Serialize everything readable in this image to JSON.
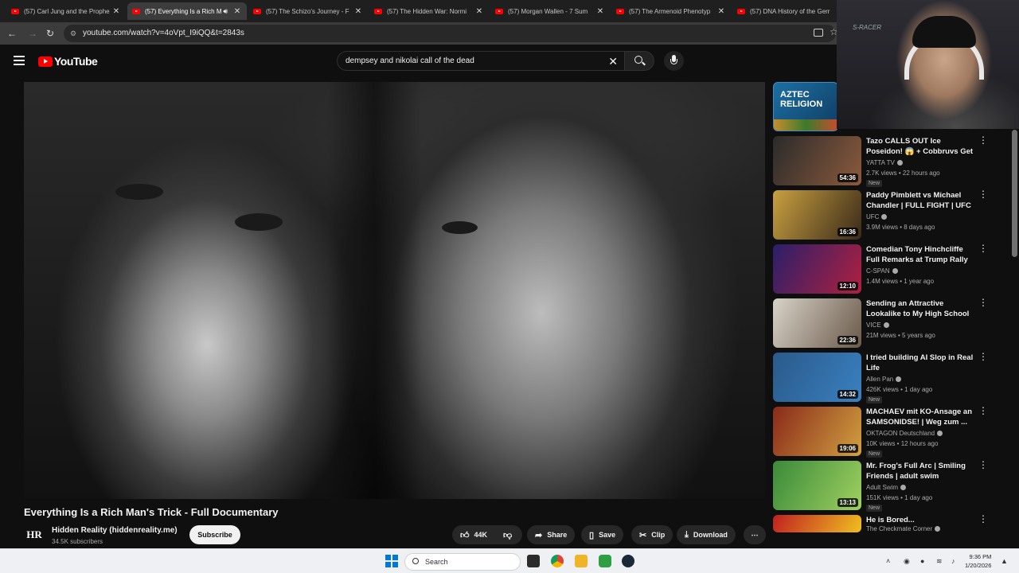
{
  "browser": {
    "tabs": [
      {
        "title": "(57) Carl Jung and the Prophe",
        "active": false,
        "audio": false
      },
      {
        "title": "(57) Everything Is a Rich M",
        "active": true,
        "audio": true
      },
      {
        "title": "(57) The Schizo's Journey - F",
        "active": false,
        "audio": false
      },
      {
        "title": "(57) The Hidden War: Normi",
        "active": false,
        "audio": false
      },
      {
        "title": "(57) Morgan Wallen - 7 Sum",
        "active": false,
        "audio": false
      },
      {
        "title": "(57) The Armenoid Phenotyp",
        "active": false,
        "audio": false
      },
      {
        "title": "(57) DNA History of the Gerr",
        "active": false,
        "audio": false
      }
    ],
    "url": "youtube.com/watch?v=4oVpt_I9iQQ&t=2843s"
  },
  "header": {
    "logo_text": "YouTube",
    "search_query": "dempsey and nikolai call of the dead"
  },
  "video": {
    "title": "Everything Is a Rich Man's Trick - Full Documentary",
    "channel": "Hidden Reality (hiddenreality.me)",
    "avatar_text": "HR",
    "subscribers": "34.5K subscribers",
    "subscribe_label": "Subscribe",
    "likes": "44K",
    "share_label": "Share",
    "save_label": "Save",
    "clip_label": "Clip",
    "download_label": "Download"
  },
  "sidebar": {
    "ad_title": "AZTEC RELIGION",
    "items": [
      {
        "title": "Tazo CALLS OUT Ice Poseidon! 😱 + Cobbruvs Get PRESSED ...",
        "channel": "YATTA TV",
        "meta": "2.7K views • 22 hours ago",
        "badge": "New",
        "duration": "54:36",
        "colors": [
          "#2b2b2b",
          "#8b5a3c"
        ]
      },
      {
        "title": "Paddy Pimblett vs Michael Chandler | FULL FIGHT | UFC ...",
        "channel": "UFC",
        "meta": "3.9M views • 8 days ago",
        "badge": "",
        "duration": "16:36",
        "colors": [
          "#c8a040",
          "#3a2a1a"
        ]
      },
      {
        "title": "Comedian Tony Hinchcliffe Full Remarks at Trump Rally at ...",
        "channel": "C-SPAN",
        "meta": "1.4M views • 1 year ago",
        "badge": "",
        "duration": "12:10",
        "colors": [
          "#2a1f6a",
          "#b02040"
        ]
      },
      {
        "title": "Sending an Attractive Lookalike to My High School Reunion",
        "channel": "VICE",
        "meta": "21M views • 5 years ago",
        "badge": "",
        "duration": "22:36",
        "colors": [
          "#d8d2c8",
          "#6a5a4a"
        ]
      },
      {
        "title": "I tried building AI Slop in Real Life",
        "channel": "Allen Pan",
        "meta": "426K views • 1 day ago",
        "badge": "New",
        "duration": "14:32",
        "colors": [
          "#2a5a8a",
          "#3a80c0"
        ]
      },
      {
        "title": "MACHAEV mit KO-Ansage an SAMSONIDSE! | Weg zum ...",
        "channel": "OKTAGON Deutschland",
        "meta": "10K views • 12 hours ago",
        "badge": "New",
        "duration": "19:06",
        "colors": [
          "#8a2a1a",
          "#d0a040"
        ]
      },
      {
        "title": "Mr. Frog's Full Arc | Smiling Friends | adult swim",
        "channel": "Adult Swim",
        "meta": "151K views • 1 day ago",
        "badge": "New",
        "duration": "13:13",
        "colors": [
          "#3a8a3a",
          "#a0d060"
        ]
      },
      {
        "title": "He is Bored...",
        "channel": "The Checkmate Corner",
        "meta": "",
        "badge": "",
        "duration": "",
        "colors": [
          "#c02020",
          "#f0c020"
        ]
      }
    ]
  },
  "webcam": {
    "label": "S-RACER"
  },
  "taskbar": {
    "search_placeholder": "Search",
    "time": "9:36 PM",
    "date": "1/20/2026"
  }
}
